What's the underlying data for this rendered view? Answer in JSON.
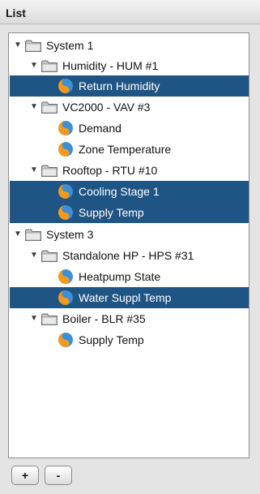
{
  "panel": {
    "title": "List"
  },
  "tree": {
    "system1": {
      "toggle": "▼",
      "label": "System 1",
      "humidity": {
        "toggle": "▼",
        "label": "Humidity - HUM #1",
        "return_humidity": "Return Humidity"
      },
      "vc2000": {
        "toggle": "▼",
        "label": "VC2000 - VAV #3",
        "demand": "Demand",
        "zone_temperature": "Zone Temperature"
      },
      "rooftop": {
        "toggle": "▼",
        "label": "Rooftop - RTU #10",
        "cooling_stage_1": "Cooling Stage 1",
        "supply_temp": "Supply Temp"
      }
    },
    "system3": {
      "toggle": "▼",
      "label": "System 3",
      "standalone": {
        "toggle": "▼",
        "label": "Standalone HP - HPS #31",
        "heatpump_state": "Heatpump State",
        "water_suppl_temp": "Water Suppl Temp"
      },
      "boiler": {
        "toggle": "▼",
        "label": "Boiler - BLR #35",
        "supply_temp": "Supply Temp"
      }
    }
  },
  "buttons": {
    "add": "+",
    "remove": "-"
  },
  "icons": {
    "folder": "folder-icon",
    "point": "sensor-point-icon"
  },
  "colors": {
    "selection": "#1f5584",
    "point_orange": "#f2991f",
    "point_blue": "#3d8fd6"
  }
}
